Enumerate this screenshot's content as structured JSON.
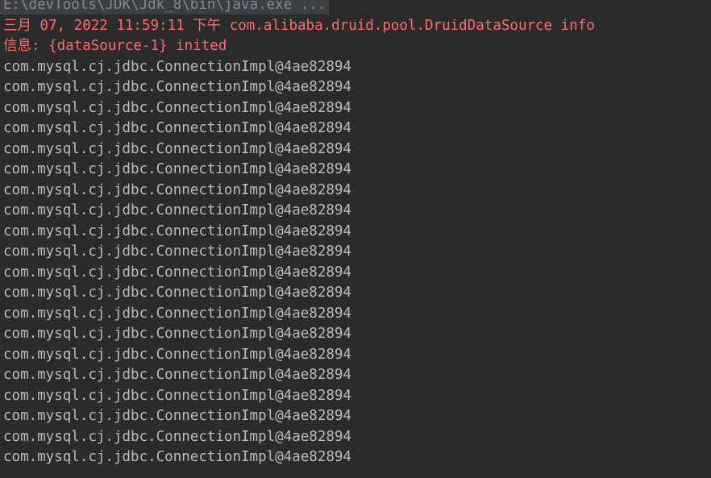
{
  "colors": {
    "background": "#2b2b2b",
    "stdout": "#bbbbbb",
    "stderr": "#ff6b68",
    "command": "#888888"
  },
  "console": {
    "command_line": "E:\\devTools\\JDK\\Jdk_8\\bin\\java.exe ...",
    "stderr_lines": [
      "三月 07, 2022 11:59:11 下午 com.alibaba.druid.pool.DruidDataSource info",
      "信息: {dataSource-1} inited"
    ],
    "stdout_lines": [
      "com.mysql.cj.jdbc.ConnectionImpl@4ae82894",
      "com.mysql.cj.jdbc.ConnectionImpl@4ae82894",
      "com.mysql.cj.jdbc.ConnectionImpl@4ae82894",
      "com.mysql.cj.jdbc.ConnectionImpl@4ae82894",
      "com.mysql.cj.jdbc.ConnectionImpl@4ae82894",
      "com.mysql.cj.jdbc.ConnectionImpl@4ae82894",
      "com.mysql.cj.jdbc.ConnectionImpl@4ae82894",
      "com.mysql.cj.jdbc.ConnectionImpl@4ae82894",
      "com.mysql.cj.jdbc.ConnectionImpl@4ae82894",
      "com.mysql.cj.jdbc.ConnectionImpl@4ae82894",
      "com.mysql.cj.jdbc.ConnectionImpl@4ae82894",
      "com.mysql.cj.jdbc.ConnectionImpl@4ae82894",
      "com.mysql.cj.jdbc.ConnectionImpl@4ae82894",
      "com.mysql.cj.jdbc.ConnectionImpl@4ae82894",
      "com.mysql.cj.jdbc.ConnectionImpl@4ae82894",
      "com.mysql.cj.jdbc.ConnectionImpl@4ae82894",
      "com.mysql.cj.jdbc.ConnectionImpl@4ae82894",
      "com.mysql.cj.jdbc.ConnectionImpl@4ae82894",
      "com.mysql.cj.jdbc.ConnectionImpl@4ae82894",
      "com.mysql.cj.jdbc.ConnectionImpl@4ae82894"
    ]
  }
}
